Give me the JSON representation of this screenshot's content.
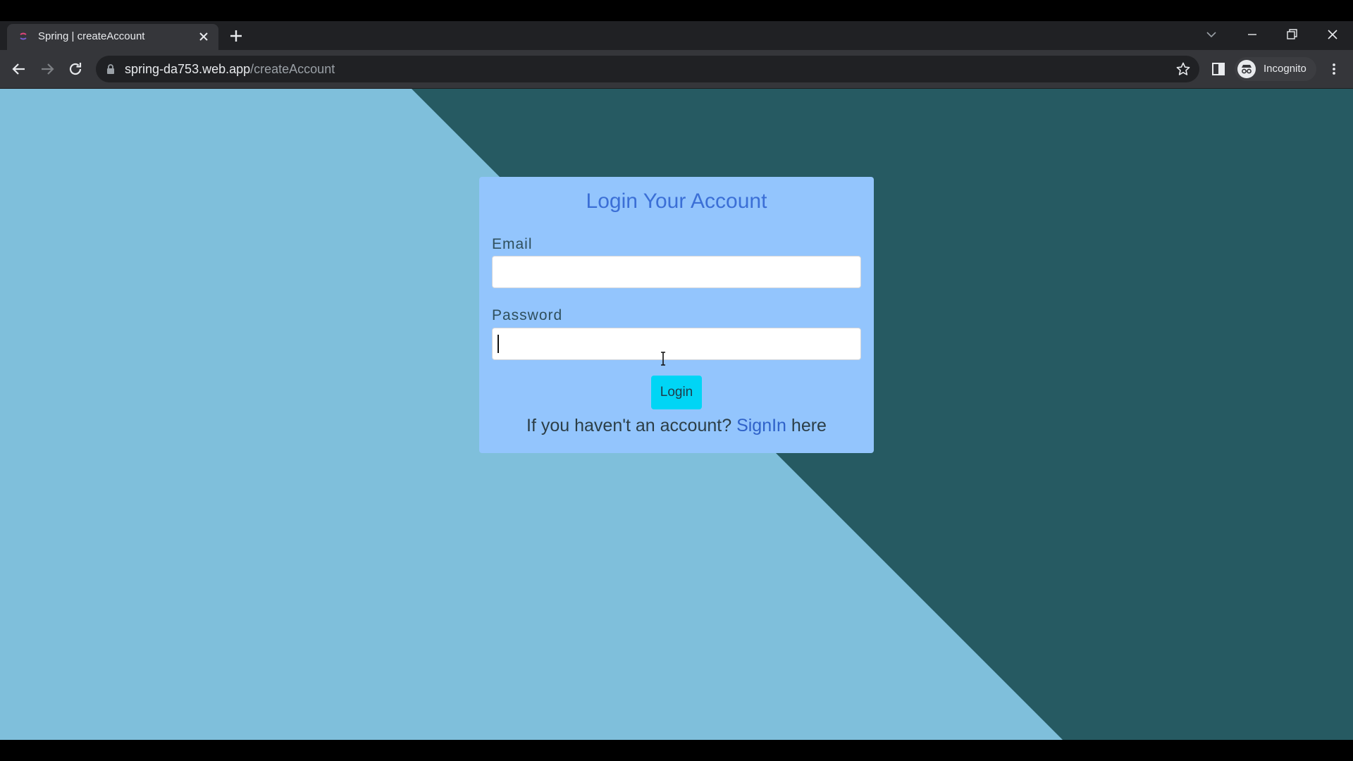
{
  "browser": {
    "tab": {
      "title": "Spring | createAccount",
      "favicon_icon": "spring-favicon-icon",
      "close_icon": "close-icon"
    },
    "new_tab_icon": "plus-icon",
    "window_controls": [
      "chevron-down-icon",
      "minimize-icon",
      "restore-icon",
      "close-icon"
    ],
    "nav": [
      "back-arrow-icon",
      "forward-arrow-icon",
      "reload-icon"
    ],
    "address": {
      "host": "spring-da753.web.app",
      "path": "/createAccount",
      "lock_icon": "lock-icon",
      "bookmark_icon": "star-icon"
    },
    "profile": {
      "label": "Incognito",
      "icon": "incognito-icon"
    },
    "menu_icon": "three-dots-vertical-icon",
    "colors": {
      "tabstrip": "#202124",
      "toolbar": "#35363a",
      "omnibox": "#202124"
    }
  },
  "page": {
    "colors": {
      "background_light": "#7fbfdb",
      "background_dark": "#265a62",
      "card": "#93c5fd",
      "title": "#3b6fd6",
      "button": "#00d5f5",
      "link": "#2f62c9"
    },
    "card": {
      "title": "Login Your Account",
      "email": {
        "label": "Email",
        "value": ""
      },
      "password": {
        "label": "Password",
        "value": ""
      },
      "login_button": "Login",
      "signup_prompt": {
        "before": "If you haven't an account?",
        "link": "SignIn",
        "after": "here"
      }
    }
  }
}
